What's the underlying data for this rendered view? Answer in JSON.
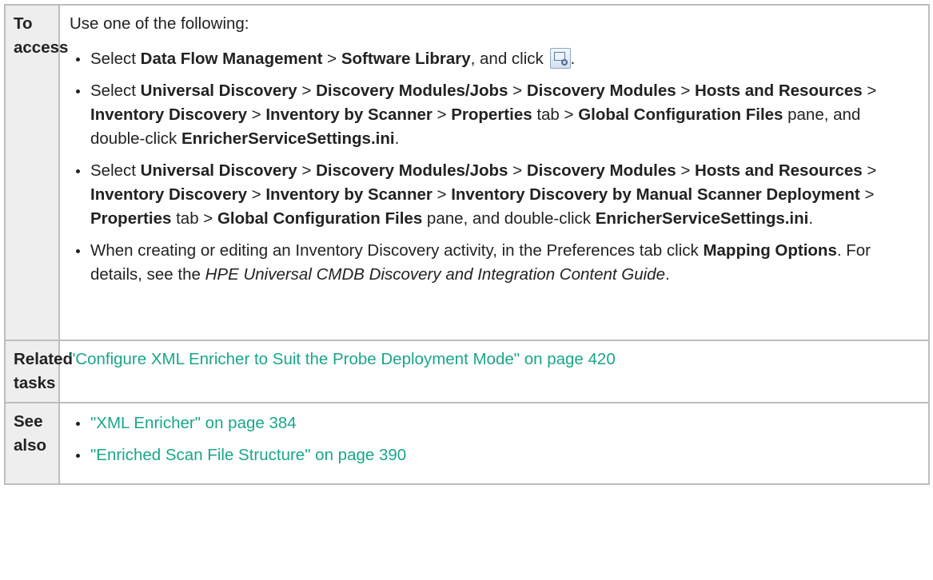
{
  "rows": {
    "access": {
      "label": "To access",
      "intro": "Use one of the following:",
      "b1": {
        "pre": "Select ",
        "t1": "Data Flow Management",
        "sep1": " > ",
        "t2": "Software Library",
        "post": ", and click ",
        "end": ".",
        "icon": "configuration-tool-icon"
      },
      "b2": {
        "pre": "Select ",
        "t1": "Universal Discovery",
        "sep1": " > ",
        "t2": "Discovery Modules/Jobs",
        "sep2": " > ",
        "t3": "Discovery Modules",
        "sep3": "  > ",
        "t4": "Hosts and Resources",
        "sep4": " > ",
        "t5": "Inventory Discovery",
        "sep5": " > ",
        "t6": "Inventory by Scanner",
        "sep6": " > ",
        "t7": "Properties",
        "mid1": " tab > ",
        "t8": "Global Configuration Files",
        "mid2": " pane, and double-click ",
        "t9": "EnricherServiceSettings.ini",
        "end": "."
      },
      "b3": {
        "pre": "Select ",
        "t1": "Universal Discovery",
        "sep1": " > ",
        "t2": "Discovery Modules/Jobs",
        "sep2": " > ",
        "t3": "Discovery Modules",
        "sep3": "  > ",
        "t4": "Hosts and Resources",
        "sep4": " > ",
        "t5": "Inventory Discovery",
        "sep5": " > ",
        "t6": "Inventory by Scanner",
        "sep6": " > ",
        "t7": "Inventory Discovery by Manual Scanner Deployment",
        "sep7": " > ",
        "t8": "Properties",
        "mid1": " tab > ",
        "t9": "Global Configuration Files",
        "mid2": " pane, and double-click ",
        "t10": "EnricherServiceSettings.ini",
        "end": "."
      },
      "b4": {
        "pre": "When creating or editing an Inventory Discovery activity, in the Preferences tab click ",
        "t1": "Mapping Options",
        "mid": ". For details, see the ",
        "guide": "HPE Universal CMDB Discovery and Integration Content Guide",
        "end": "."
      }
    },
    "related": {
      "label": "Related tasks",
      "link": "\"Configure XML Enricher to Suit the Probe Deployment Mode\" on page 420"
    },
    "see_also": {
      "label": "See also",
      "links": [
        "\"XML Enricher\" on page 384",
        "\"Enriched Scan File Structure\" on page 390"
      ]
    }
  },
  "colors": {
    "link": "#19a68b",
    "header_bg": "#eeeeee",
    "border": "#bdbdbd"
  }
}
